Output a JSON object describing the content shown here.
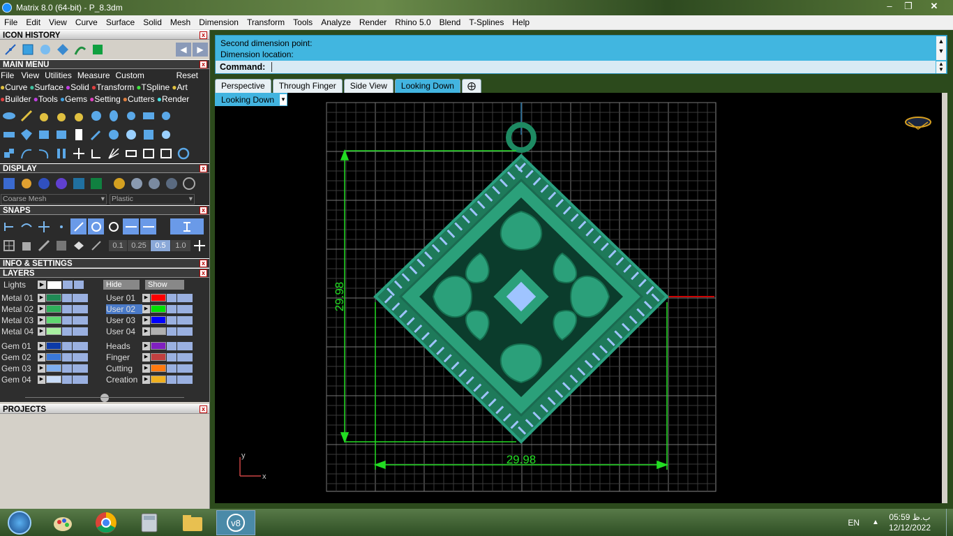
{
  "window": {
    "title": "Matrix 8.0 (64-bit) - P_8.3dm"
  },
  "menubar": [
    "File",
    "Edit",
    "View",
    "Curve",
    "Surface",
    "Solid",
    "Mesh",
    "Dimension",
    "Transform",
    "Tools",
    "Analyze",
    "Render",
    "Rhino 5.0",
    "Blend",
    "T-Splines",
    "Help"
  ],
  "panels": {
    "icon_history": "ICON HISTORY",
    "main_menu": "MAIN MENU",
    "display": "DISPLAY",
    "snaps": "SNAPS",
    "info": "INFO & SETTINGS",
    "layers": "LAYERS",
    "projects": "PROJECTS"
  },
  "main_menu": {
    "items": [
      "File",
      "View",
      "Utilities",
      "Measure",
      "Custom"
    ],
    "reset": "Reset",
    "cats1": [
      "Curve",
      "Surface",
      "Solid",
      "Transform",
      "TSpline",
      "Art"
    ],
    "cats2": [
      "Builder",
      "Tools",
      "Gems",
      "Setting",
      "Cutters",
      "Render"
    ]
  },
  "display": {
    "mesh": "Coarse Mesh",
    "material": "Plastic"
  },
  "snaps": {
    "vals": [
      "0.1",
      "0.25",
      "0.5",
      "1.0"
    ]
  },
  "layers": {
    "lights": "Lights",
    "hide": "Hide",
    "show": "Show",
    "left": [
      {
        "name": "Metal 01",
        "color": "#1f8a55"
      },
      {
        "name": "Metal 02",
        "color": "#2fb05a"
      },
      {
        "name": "Metal 03",
        "color": "#5fd870"
      },
      {
        "name": "Metal 04",
        "color": "#a8f0a0"
      },
      {
        "name": "Gem 01",
        "color": "#0b3aa8"
      },
      {
        "name": "Gem 02",
        "color": "#3a78d8"
      },
      {
        "name": "Gem 03",
        "color": "#7fb0f0"
      },
      {
        "name": "Gem 04",
        "color": "#c8dcf8"
      }
    ],
    "right": [
      {
        "name": "User 01",
        "color": "#ff0000"
      },
      {
        "name": "User 02",
        "color": "#00e000"
      },
      {
        "name": "User 03",
        "color": "#0000ff"
      },
      {
        "name": "User 04",
        "color": "#b0b0b0"
      },
      {
        "name": "Heads",
        "color": "#8020c0"
      },
      {
        "name": "Finger",
        "color": "#c04040"
      },
      {
        "name": "Cutting",
        "color": "#ff7a10"
      },
      {
        "name": "Creation",
        "color": "#f0b020"
      }
    ]
  },
  "command": {
    "line1": "Second dimension point:",
    "line2": "Dimension location:",
    "label": "Command:",
    "value": ""
  },
  "tabs": [
    "Perspective",
    "Through Finger",
    "Side View",
    "Looking Down"
  ],
  "viewport": {
    "name": "Looking Down",
    "dim_h": "29.98",
    "dim_v": "29.98",
    "axis_y": "y",
    "axis_x": "x"
  },
  "taskbar": {
    "lang": "EN",
    "time": "05:59 ب.ظ",
    "date": "12/12/2022"
  },
  "colors": {
    "accent": "#41b6e0",
    "metal": "#1e8a62",
    "gem": "#9fc4ff",
    "dim": "#22dd22"
  }
}
